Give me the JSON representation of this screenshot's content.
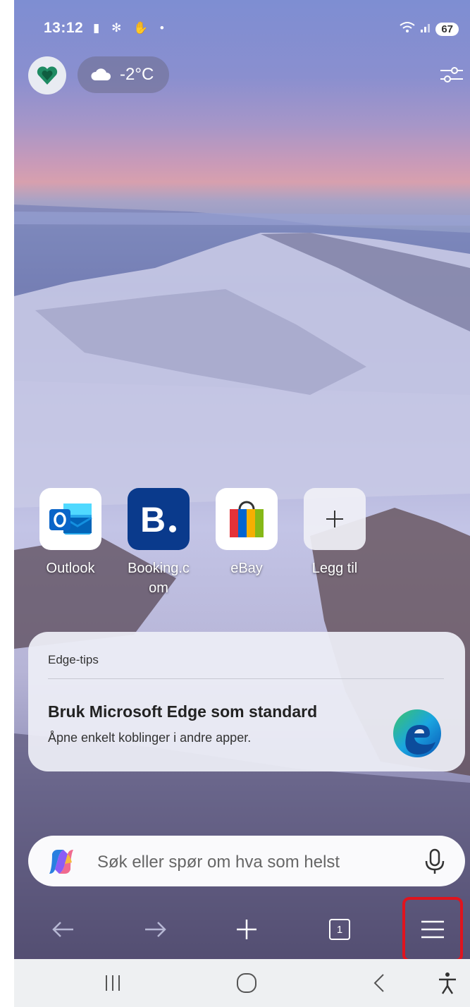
{
  "status_bar": {
    "time": "13:12",
    "notification_icons": [
      "display-icon",
      "snowflake-icon",
      "hand-icon",
      "dot-icon"
    ],
    "battery": "67"
  },
  "header": {
    "weather": "-2°C"
  },
  "shortcuts": [
    {
      "label": "Outlook",
      "icon": "outlook-icon"
    },
    {
      "label": "Booking.c\nom",
      "icon": "booking-icon"
    },
    {
      "label": "eBay",
      "icon": "ebay-icon"
    },
    {
      "label": "Legg til",
      "icon": "plus-icon"
    }
  ],
  "tips": {
    "header": "Edge-tips",
    "title": "Bruk Microsoft Edge som standard",
    "subtitle": "Åpne enkelt koblinger i andre apper."
  },
  "search": {
    "placeholder": "Søk eller spør om hva som helst"
  },
  "toolbar": {
    "tab_count": "1"
  },
  "colors": {
    "highlight": "#e0141e",
    "booking_blue": "#0a3a8c",
    "outlook_blue": "#0a64c8"
  }
}
